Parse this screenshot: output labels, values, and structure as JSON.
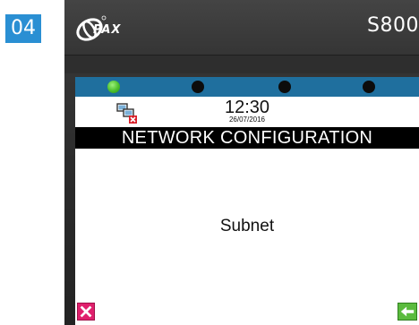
{
  "step": {
    "number": "04"
  },
  "device": {
    "brand": "PAX",
    "model": "S800"
  },
  "screen": {
    "leds": [
      {
        "state": "on",
        "color": "#4bbf2c"
      },
      {
        "state": "off",
        "color": "#0c0c0c"
      },
      {
        "state": "off",
        "color": "#0c0c0c"
      },
      {
        "state": "off",
        "color": "#0c0c0c"
      }
    ],
    "status": {
      "time": "12:30",
      "date": "26/07/2016",
      "network_icon": "network-disconnected-icon"
    },
    "title": "NETWORK CONFIGURATION",
    "field_label": "Subnet",
    "buttons": {
      "cancel_icon": "cancel-x-icon",
      "cancel_color": "#e0206d",
      "back_icon": "back-arrow-icon",
      "back_color": "#5bbb3e"
    }
  },
  "colors": {
    "step_badge": "#2a8fd3",
    "led_bar": "#1f6f9e",
    "title_bar": "#000000"
  }
}
